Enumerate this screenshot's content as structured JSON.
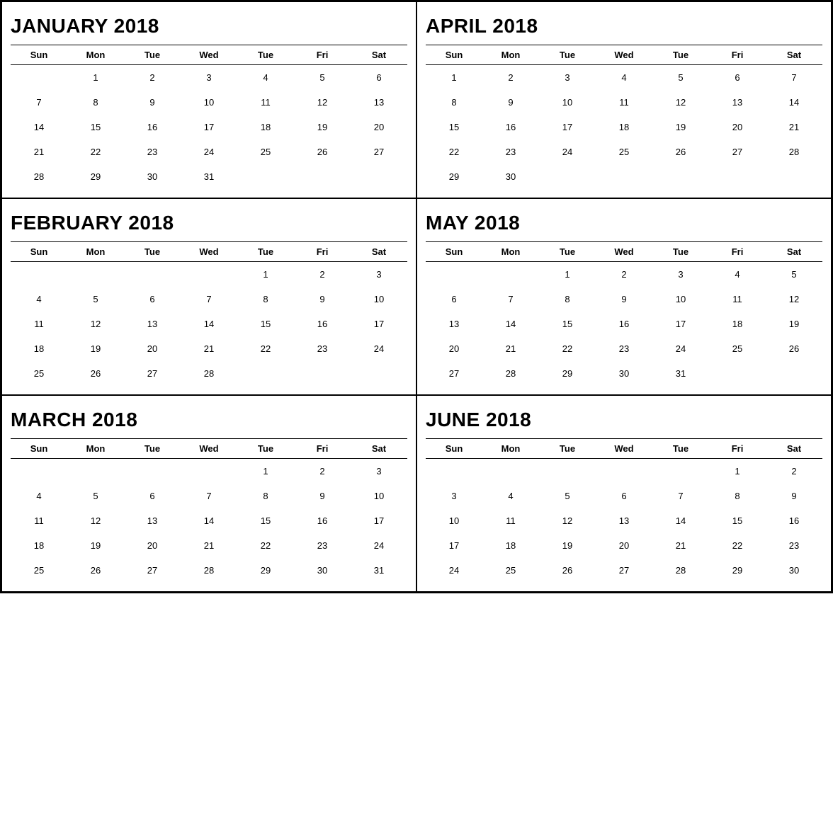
{
  "months": [
    {
      "id": "january-2018",
      "title": "JANUARY 2018",
      "headers": [
        "Sun",
        "Mon",
        "Tue",
        "Wed",
        "Tue",
        "Fri",
        "Sat"
      ],
      "weeks": [
        [
          "",
          "1",
          "2",
          "3",
          "4",
          "5",
          "6"
        ],
        [
          "7",
          "8",
          "9",
          "10",
          "11",
          "12",
          "13"
        ],
        [
          "14",
          "15",
          "16",
          "17",
          "18",
          "19",
          "20"
        ],
        [
          "21",
          "22",
          "23",
          "24",
          "25",
          "26",
          "27"
        ],
        [
          "28",
          "29",
          "30",
          "31",
          "",
          "",
          ""
        ]
      ]
    },
    {
      "id": "april-2018",
      "title": "APRIL 2018",
      "headers": [
        "Sun",
        "Mon",
        "Tue",
        "Wed",
        "Tue",
        "Fri",
        "Sat"
      ],
      "weeks": [
        [
          "1",
          "2",
          "3",
          "4",
          "5",
          "6",
          "7"
        ],
        [
          "8",
          "9",
          "10",
          "11",
          "12",
          "13",
          "14"
        ],
        [
          "15",
          "16",
          "17",
          "18",
          "19",
          "20",
          "21"
        ],
        [
          "22",
          "23",
          "24",
          "25",
          "26",
          "27",
          "28"
        ],
        [
          "29",
          "30",
          "",
          "",
          "",
          "",
          ""
        ]
      ]
    },
    {
      "id": "february-2018",
      "title": "FEBRUARY 2018",
      "headers": [
        "Sun",
        "Mon",
        "Tue",
        "Wed",
        "Tue",
        "Fri",
        "Sat"
      ],
      "weeks": [
        [
          "",
          "",
          "",
          "",
          "1",
          "2",
          "3"
        ],
        [
          "4",
          "5",
          "6",
          "7",
          "8",
          "9",
          "10"
        ],
        [
          "11",
          "12",
          "13",
          "14",
          "15",
          "16",
          "17"
        ],
        [
          "18",
          "19",
          "20",
          "21",
          "22",
          "23",
          "24"
        ],
        [
          "25",
          "26",
          "27",
          "28",
          "",
          "",
          ""
        ]
      ]
    },
    {
      "id": "may-2018",
      "title": "MAY 2018",
      "headers": [
        "Sun",
        "Mon",
        "Tue",
        "Wed",
        "Tue",
        "Fri",
        "Sat"
      ],
      "weeks": [
        [
          "",
          "",
          "1",
          "2",
          "3",
          "4",
          "5"
        ],
        [
          "6",
          "7",
          "8",
          "9",
          "10",
          "11",
          "12"
        ],
        [
          "13",
          "14",
          "15",
          "16",
          "17",
          "18",
          "19"
        ],
        [
          "20",
          "21",
          "22",
          "23",
          "24",
          "25",
          "26"
        ],
        [
          "27",
          "28",
          "29",
          "30",
          "31",
          "",
          ""
        ]
      ]
    },
    {
      "id": "march-2018",
      "title": "MARCH 2018",
      "headers": [
        "Sun",
        "Mon",
        "Tue",
        "Wed",
        "Tue",
        "Fri",
        "Sat"
      ],
      "weeks": [
        [
          "",
          "",
          "",
          "",
          "1",
          "2",
          "3"
        ],
        [
          "4",
          "5",
          "6",
          "7",
          "8",
          "9",
          "10"
        ],
        [
          "11",
          "12",
          "13",
          "14",
          "15",
          "16",
          "17"
        ],
        [
          "18",
          "19",
          "20",
          "21",
          "22",
          "23",
          "24"
        ],
        [
          "25",
          "26",
          "27",
          "28",
          "29",
          "30",
          "31"
        ]
      ]
    },
    {
      "id": "june-2018",
      "title": "JUNE 2018",
      "headers": [
        "Sun",
        "Mon",
        "Tue",
        "Wed",
        "Tue",
        "Fri",
        "Sat"
      ],
      "weeks": [
        [
          "",
          "",
          "",
          "",
          "",
          "1",
          "2"
        ],
        [
          "3",
          "4",
          "5",
          "6",
          "7",
          "8",
          "9"
        ],
        [
          "10",
          "11",
          "12",
          "13",
          "14",
          "15",
          "16"
        ],
        [
          "17",
          "18",
          "19",
          "20",
          "21",
          "22",
          "23"
        ],
        [
          "24",
          "25",
          "26",
          "27",
          "28",
          "29",
          "30"
        ]
      ]
    }
  ]
}
